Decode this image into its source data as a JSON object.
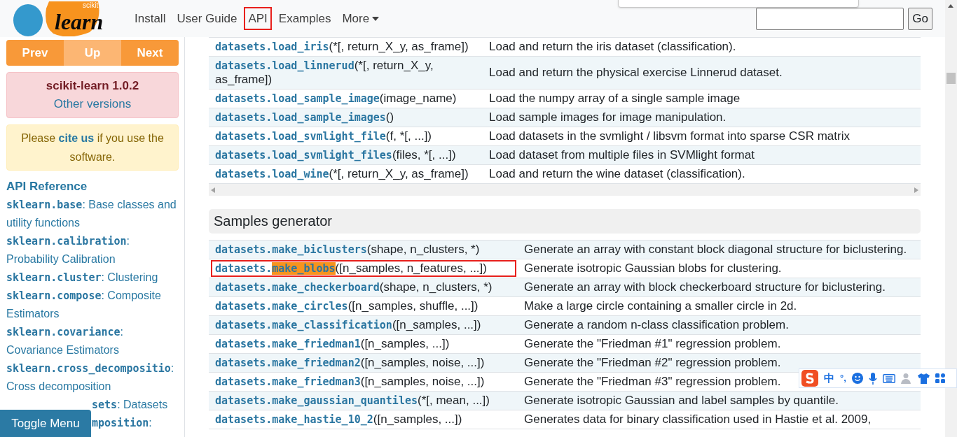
{
  "header": {
    "logo": {
      "small": "scikit",
      "big": "learn"
    },
    "nav": [
      {
        "label": "Install",
        "outlined": false,
        "dropdown": false
      },
      {
        "label": "User Guide",
        "outlined": false,
        "dropdown": false
      },
      {
        "label": "API",
        "outlined": true,
        "dropdown": false
      },
      {
        "label": "Examples",
        "outlined": false,
        "dropdown": false
      },
      {
        "label": "More",
        "outlined": false,
        "dropdown": true
      }
    ],
    "search_button": "Go"
  },
  "sidebar": {
    "pager": [
      {
        "label": "Prev",
        "muted": false
      },
      {
        "label": "Up",
        "muted": true
      },
      {
        "label": "Next",
        "muted": false
      }
    ],
    "version": {
      "title": "scikit-learn 1.0.2",
      "link": "Other versions"
    },
    "cite": {
      "before": "Please",
      "link": "cite us",
      "after": "if you use the software."
    },
    "heading": "API Reference",
    "modules": [
      {
        "code": "sklearn.base",
        "desc": ": Base classes and utility functions"
      },
      {
        "code": "sklearn.calibration",
        "desc": ": Probability Calibration"
      },
      {
        "code": "sklearn.cluster",
        "desc": ": Clustering"
      },
      {
        "code": "sklearn.compose",
        "desc": ": Composite Estimators"
      },
      {
        "code": "sklearn.covariance",
        "desc": ": Covariance Estimators"
      },
      {
        "code": "sklearn.cross_decompositio",
        "desc": ": Cross decomposition"
      },
      {
        "code": "sets",
        "desc": ": Datasets",
        "kind": "covered"
      },
      {
        "code": "mposition",
        "desc": ":",
        "kind": "covered"
      }
    ],
    "toggle": "Toggle Menu"
  },
  "loaders": [
    {
      "module": "datasets.",
      "name": "load_iris",
      "args": "(*[, return_X_y, as_frame])",
      "desc": "Load and return the iris dataset (classification).",
      "outlined": false,
      "name_marked": false
    },
    {
      "module": "datasets.",
      "name": "load_linnerud",
      "args": "(*[, return_X_y, as_frame])",
      "desc": "Load and return the physical exercise Linnerud dataset.",
      "outlined": false,
      "name_marked": false
    },
    {
      "module": "datasets.",
      "name": "load_sample_image",
      "args": "(image_name)",
      "desc": "Load the numpy array of a single sample image",
      "outlined": false,
      "name_marked": false
    },
    {
      "module": "datasets.",
      "name": "load_sample_images",
      "args": "()",
      "desc": "Load sample images for image manipulation.",
      "outlined": false,
      "name_marked": false
    },
    {
      "module": "datasets.",
      "name": "load_svmlight_file",
      "args": "(f, *[, ...])",
      "desc": "Load datasets in the svmlight / libsvm format into sparse CSR matrix",
      "outlined": false,
      "name_marked": false
    },
    {
      "module": "datasets.",
      "name": "load_svmlight_files",
      "args": "(files, *[, ...])",
      "desc": "Load dataset from multiple files in SVMlight format",
      "outlined": false,
      "name_marked": false
    },
    {
      "module": "datasets.",
      "name": "load_wine",
      "args": "(*[, return_X_y, as_frame])",
      "desc": "Load and return the wine dataset (classification).",
      "outlined": false,
      "name_marked": false
    }
  ],
  "section_title": "Samples generator",
  "generators": [
    {
      "module": "datasets.",
      "name": "make_biclusters",
      "args": "(shape, n_clusters, *)",
      "desc": "Generate an array with constant block diagonal structure for biclustering.",
      "outlined": false,
      "name_marked": false
    },
    {
      "module": "datasets.",
      "name": "make_blobs",
      "args": "([n_samples, n_features, ...])",
      "desc": "Generate isotropic Gaussian blobs for clustering.",
      "outlined": true,
      "name_marked": true
    },
    {
      "module": "datasets.",
      "name": "make_checkerboard",
      "args": "(shape, n_clusters, *)",
      "desc": "Generate an array with block checkerboard structure for biclustering.",
      "outlined": false,
      "name_marked": false
    },
    {
      "module": "datasets.",
      "name": "make_circles",
      "args": "([n_samples, shuffle, ...])",
      "desc": "Make a large circle containing a smaller circle in 2d.",
      "outlined": false,
      "name_marked": false
    },
    {
      "module": "datasets.",
      "name": "make_classification",
      "args": "([n_samples, ...])",
      "desc": "Generate a random n-class classification problem.",
      "outlined": false,
      "name_marked": false
    },
    {
      "module": "datasets.",
      "name": "make_friedman1",
      "args": "([n_samples, ...])",
      "desc": "Generate the \"Friedman #1\" regression problem.",
      "outlined": false,
      "name_marked": false
    },
    {
      "module": "datasets.",
      "name": "make_friedman2",
      "args": "([n_samples, noise, ...])",
      "desc": "Generate the \"Friedman #2\" regression problem.",
      "outlined": false,
      "name_marked": false
    },
    {
      "module": "datasets.",
      "name": "make_friedman3",
      "args": "([n_samples, noise, ...])",
      "desc": "Generate the \"Friedman #3\" regression problem.",
      "outlined": false,
      "name_marked": false
    },
    {
      "module": "datasets.",
      "name": "make_gaussian_quantiles",
      "args": "(*[, mean, ...])",
      "desc": "Generate isotropic Gaussian and label samples by quantile.",
      "outlined": false,
      "name_marked": false
    },
    {
      "module": "datasets.",
      "name": "make_hastie_10_2",
      "args": "([n_samples, ...])",
      "desc": "Generates data for binary classification used in Hastie et al. 2009,",
      "outlined": false,
      "name_marked": false
    }
  ],
  "ime": {
    "lang": "中",
    "punct": "°,"
  }
}
